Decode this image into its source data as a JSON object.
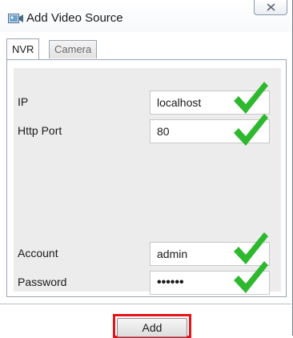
{
  "window": {
    "title": "Add Video Source",
    "icon": "video-camera-app-icon",
    "close_icon": "close-icon"
  },
  "tabs": [
    {
      "label": "NVR",
      "selected": true
    },
    {
      "label": "Camera",
      "selected": false
    }
  ],
  "form": {
    "ip": {
      "label": "IP",
      "value": "localhost",
      "valid": true
    },
    "http_port": {
      "label": "Http Port",
      "value": "80",
      "valid": true
    },
    "account": {
      "label": "Account",
      "value": "admin",
      "valid": true
    },
    "password": {
      "label": "Password",
      "value": "••••••",
      "valid": true
    }
  },
  "footer": {
    "add_label": "Add"
  },
  "colors": {
    "check_green": "#2eb82e",
    "highlight_red": "#e4141b"
  }
}
